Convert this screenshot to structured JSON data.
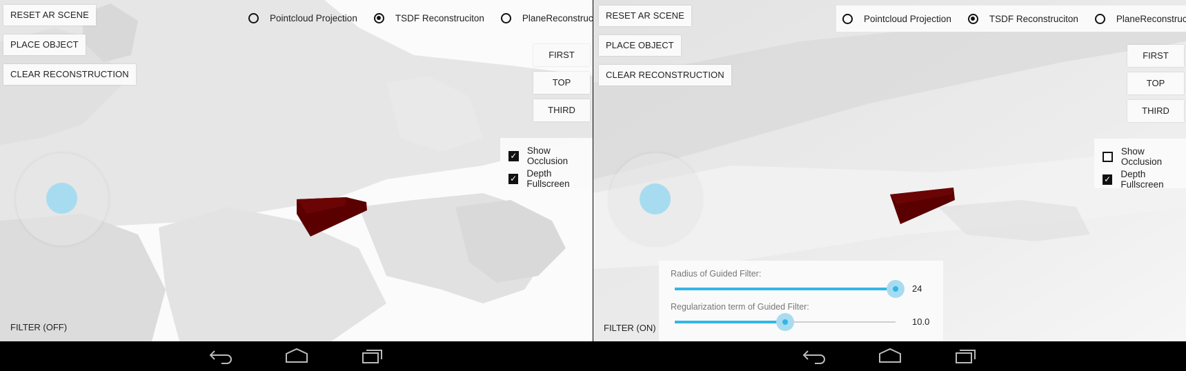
{
  "panels": [
    {
      "buttons": {
        "reset": "RESET AR SCENE",
        "place": "PLACE OBJECT",
        "clear": "CLEAR RECONSTRUCTION",
        "first": "FIRST",
        "top": "TOP",
        "third": "THIRD"
      },
      "modes": [
        {
          "label": "Pointcloud Projection",
          "selected": false
        },
        {
          "label": "TSDF Reconstruciton",
          "selected": true
        },
        {
          "label": "PlaneReconstruciton",
          "selected": false
        }
      ],
      "checks": [
        {
          "label": "Show Occlusion",
          "checked": true
        },
        {
          "label": "Depth Fullscreen",
          "checked": true
        }
      ],
      "filter_label": "FILTER (OFF)"
    },
    {
      "buttons": {
        "reset": "RESET AR SCENE",
        "place": "PLACE OBJECT",
        "clear": "CLEAR RECONSTRUCTION",
        "first": "FIRST",
        "top": "TOP",
        "third": "THIRD"
      },
      "modes": [
        {
          "label": "Pointcloud Projection",
          "selected": false
        },
        {
          "label": "TSDF Reconstruciton",
          "selected": true
        },
        {
          "label": "PlaneReconstruciton",
          "selected": false
        }
      ],
      "checks": [
        {
          "label": "Show Occlusion",
          "checked": false
        },
        {
          "label": "Depth Fullscreen",
          "checked": true
        }
      ],
      "filter_label": "FILTER (ON)",
      "sliders": [
        {
          "label": "Radius of Guided Filter:",
          "value": "24",
          "fraction": 1.0
        },
        {
          "label": "Regularization term of Guided Filter:",
          "value": "10.0",
          "fraction": 0.5
        }
      ]
    }
  ],
  "navbar": {
    "icons": [
      "back-icon",
      "home-icon",
      "recent-apps-icon"
    ]
  },
  "colors": {
    "object": "#5a0000",
    "accent": "#33b5e5",
    "joystick_knob": "#a7dcf0",
    "navbar": "#000000"
  }
}
